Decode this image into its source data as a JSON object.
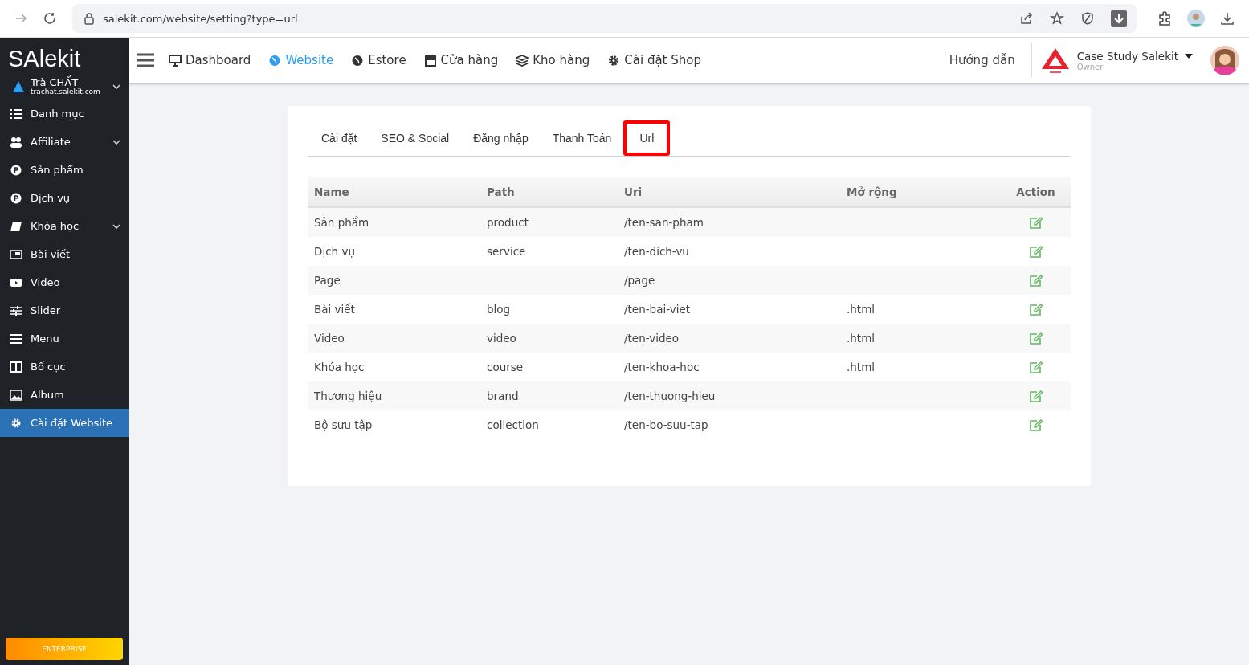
{
  "browser": {
    "url": "salekit.com/website/setting?type=url"
  },
  "sidebar": {
    "logo": "SAlekit",
    "shop": {
      "name": "Trà CHẤT",
      "domain": "trachat.salekit.com"
    },
    "items": [
      {
        "label": "Danh mục",
        "expandable": false,
        "selected": false
      },
      {
        "label": "Affiliate",
        "expandable": true,
        "selected": false
      },
      {
        "label": "Sản phẩm",
        "expandable": false,
        "selected": false
      },
      {
        "label": "Dịch vụ",
        "expandable": false,
        "selected": false
      },
      {
        "label": "Khóa học",
        "expandable": true,
        "selected": false
      },
      {
        "label": "Bài viết",
        "expandable": false,
        "selected": false
      },
      {
        "label": "Video",
        "expandable": false,
        "selected": false
      },
      {
        "label": "Slider",
        "expandable": false,
        "selected": false
      },
      {
        "label": "Menu",
        "expandable": false,
        "selected": false
      },
      {
        "label": "Bố cục",
        "expandable": false,
        "selected": false
      },
      {
        "label": "Album",
        "expandable": false,
        "selected": false
      },
      {
        "label": "Cài đặt Website",
        "expandable": false,
        "selected": true
      }
    ],
    "plan": "ENTERPRISE"
  },
  "nav": {
    "items": [
      {
        "label": "Dashboard",
        "selected": false
      },
      {
        "label": "Website",
        "selected": true
      },
      {
        "label": "Estore",
        "selected": false
      },
      {
        "label": "Cửa hàng",
        "selected": false
      },
      {
        "label": "Kho hàng",
        "selected": false
      },
      {
        "label": "Cài đặt Shop",
        "selected": false
      }
    ],
    "help": "Hướng dẫn",
    "account": {
      "name": "Case Study Salekit",
      "role": "Owner"
    }
  },
  "tabs": [
    {
      "label": "Cài đặt",
      "selected": false
    },
    {
      "label": "SEO & Social",
      "selected": false
    },
    {
      "label": "Đăng nhập",
      "selected": false
    },
    {
      "label": "Thanh Toán",
      "selected": false
    },
    {
      "label": "Url",
      "selected": true
    }
  ],
  "table": {
    "columns": [
      "Name",
      "Path",
      "Uri",
      "Mở rộng",
      "Action"
    ],
    "rows": [
      [
        "Sản phẩm",
        "product",
        "/ten-san-pham",
        ""
      ],
      [
        "Dịch vụ",
        "service",
        "/ten-dich-vu",
        ""
      ],
      [
        "Page",
        "",
        "/page",
        ""
      ],
      [
        "Bài viết",
        "blog",
        "/ten-bai-viet",
        ".html"
      ],
      [
        "Video",
        "video",
        "/ten-video",
        ".html"
      ],
      [
        "Khóa học",
        "course",
        "/ten-khoa-hoc",
        ".html"
      ],
      [
        "Thương hiệu",
        "brand",
        "/ten-thuong-hieu",
        ""
      ],
      [
        "Bộ sưu tập",
        "collection",
        "/ten-bo-suu-tap",
        ""
      ]
    ]
  }
}
